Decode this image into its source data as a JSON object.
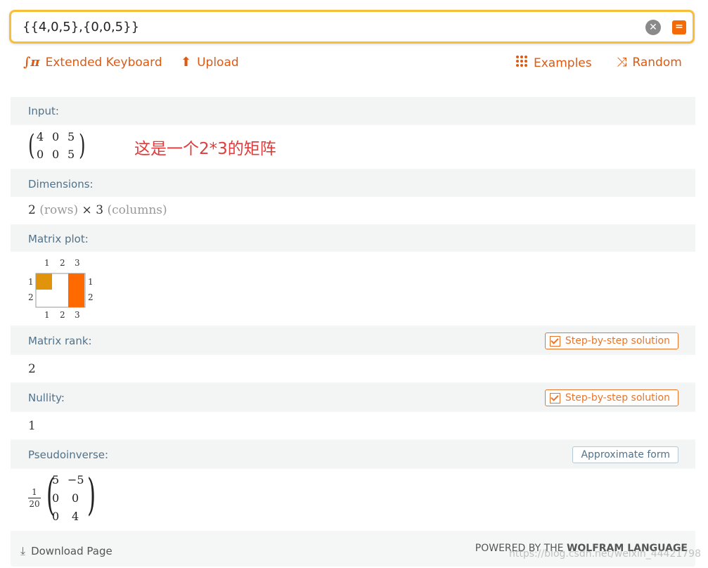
{
  "search": {
    "value": "{{4,0,5},{0,0,5}}",
    "clear_icon": "clear-icon",
    "submit_icon": "equals-icon"
  },
  "toolbar": {
    "extended_keyboard": "Extended Keyboard",
    "upload": "Upload",
    "examples": "Examples",
    "random": "Random"
  },
  "pods": {
    "input": {
      "title": "Input:",
      "matrix": [
        [
          "4",
          "0",
          "5"
        ],
        [
          "0",
          "0",
          "5"
        ]
      ],
      "annotation": "这是一个2*3的矩阵"
    },
    "dimensions": {
      "title": "Dimensions:",
      "rows_value": "2",
      "rows_label": "(rows)",
      "times": "×",
      "cols_value": "3",
      "cols_label": "(columns)"
    },
    "matrix_plot": {
      "title": "Matrix plot:",
      "col_ticks": [
        "1",
        "2",
        "3"
      ],
      "row_ticks": [
        "1",
        "2"
      ]
    },
    "rank": {
      "title": "Matrix rank:",
      "value": "2",
      "button": "Step-by-step solution"
    },
    "nullity": {
      "title": "Nullity:",
      "value": "1",
      "button": "Step-by-step solution"
    },
    "pseudoinverse": {
      "title": "Pseudoinverse:",
      "button": "Approximate form",
      "factor_num": "1",
      "factor_den": "20",
      "matrix": [
        [
          "5",
          "−5"
        ],
        [
          "0",
          "0"
        ],
        [
          "0",
          "4"
        ]
      ]
    }
  },
  "footer": {
    "download": "Download Page",
    "powered_prefix": "POWERED BY THE ",
    "powered_brand": "WOLFRAM LANGUAGE",
    "watermark": "https://blog.csdn.net/weixin_44421798"
  },
  "colors": {
    "accent": "#dd5a12",
    "search_border": "#f8be3a",
    "pod_label": "#51728a",
    "plot_mid": "#e0940b",
    "plot_high": "#ff6a00"
  }
}
